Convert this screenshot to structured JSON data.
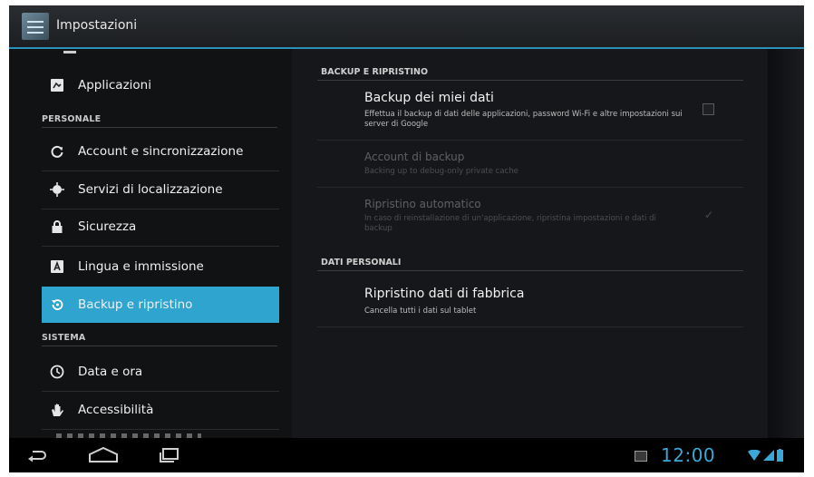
{
  "action_bar": {
    "title": "Impostazioni"
  },
  "left_panel": {
    "items_top": [
      {
        "label": "Applicazioni",
        "icon": "apps-icon"
      }
    ],
    "categories": {
      "personale": "PERSONALE",
      "sistema": "SISTEMA"
    },
    "personale_items": [
      {
        "label": "Account e sincronizzazione",
        "icon": "sync-icon"
      },
      {
        "label": "Servizi di localizzazione",
        "icon": "location-icon"
      },
      {
        "label": "Sicurezza",
        "icon": "lock-icon"
      },
      {
        "label": "Lingua e immissione",
        "icon": "language-icon"
      },
      {
        "label": "Backup e ripristino",
        "icon": "backup-icon",
        "selected": true
      }
    ],
    "sistema_items": [
      {
        "label": "Data e ora",
        "icon": "clock-icon"
      },
      {
        "label": "Accessibilità",
        "icon": "hand-icon"
      }
    ]
  },
  "right_panel": {
    "section_backup": {
      "header": "BACKUP E RIPRISTINO",
      "backup_data": {
        "title": "Backup dei miei dati",
        "summary": "Effettua il backup di dati delle applicazioni, password Wi-Fi e altre impostazioni sui server di Google"
      },
      "backup_account": {
        "title": "Account di backup",
        "summary": "Backing up to debug-only private cache"
      },
      "auto_restore": {
        "title": "Ripristino automatico",
        "summary": "In caso di reinstallazione di un'applicazione, ripristina impostazioni e dati di backup"
      }
    },
    "section_personal": {
      "header": "DATI PERSONALI",
      "factory_reset": {
        "title": "Ripristino dati di fabbrica",
        "summary": "Cancella tutti i dati sul tablet"
      }
    }
  },
  "system_bar": {
    "clock": "12:00",
    "accent": "#3aa7d8"
  },
  "colors": {
    "selected_item": "#2fa4cf",
    "action_bar_underline": "#2d90b8"
  }
}
